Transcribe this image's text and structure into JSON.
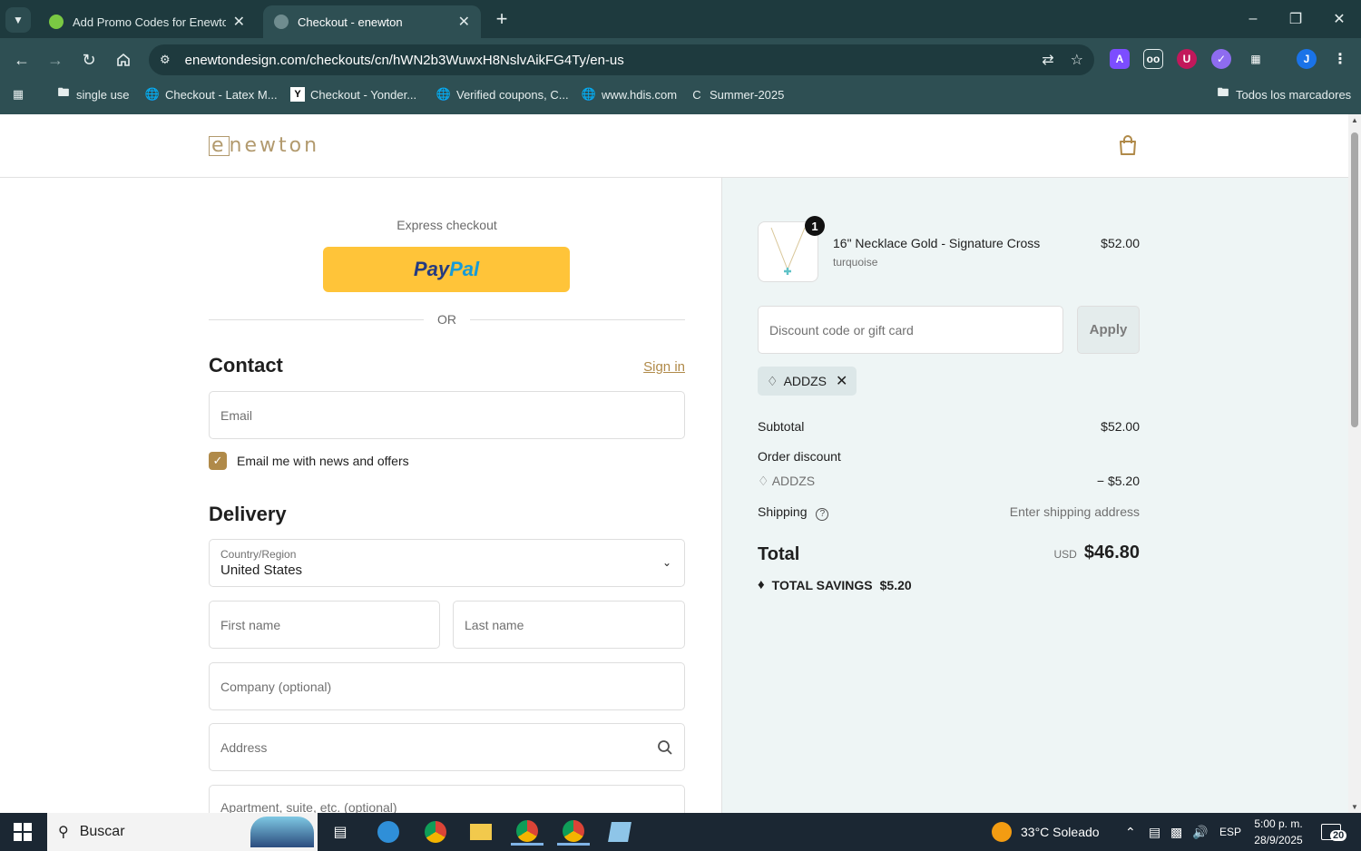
{
  "browser": {
    "tabs": [
      {
        "title": "Add Promo Codes for Enewton",
        "active": false
      },
      {
        "title": "Checkout - enewton",
        "active": true
      }
    ],
    "url": "enewtondesign.com/checkouts/cn/hWN2b3WuwxH8NslvAikFG4Ty/en-us",
    "bookmarks": [
      {
        "label": "single use",
        "icon": "folder-icon"
      },
      {
        "label": "Checkout - Latex M...",
        "icon": "globe-icon"
      },
      {
        "label": "Checkout - Yonder...",
        "icon": "yonder-icon"
      },
      {
        "label": "Verified coupons, C...",
        "icon": "globe-icon"
      },
      {
        "label": "www.hdis.com",
        "icon": "globe-icon"
      },
      {
        "label": "Summer-2025",
        "icon": "c-icon"
      },
      {
        "label": "Todos los marcadores",
        "icon": "folder-icon"
      }
    ],
    "profile_initial": "J"
  },
  "header": {
    "logo_letter": "e",
    "logo_rest": "newton"
  },
  "checkout": {
    "express_label": "Express checkout",
    "paypal_pay": "Pay",
    "paypal_pal": "Pal",
    "or_label": "OR",
    "contact_title": "Contact",
    "sign_in": "Sign in",
    "email_placeholder": "Email",
    "newsletter_label": "Email me with news and offers",
    "newsletter_checked": true,
    "delivery_title": "Delivery",
    "country_label": "Country/Region",
    "country_value": "United States",
    "first_name_placeholder": "First name",
    "last_name_placeholder": "Last name",
    "company_placeholder": "Company (optional)",
    "address_placeholder": "Address",
    "apartment_placeholder": "Apartment, suite, etc. (optional)"
  },
  "summary": {
    "item": {
      "quantity": "1",
      "name": "16\" Necklace Gold - Signature Cross",
      "variant": "turquoise",
      "price": "$52.00"
    },
    "discount_placeholder": "Discount code or gift card",
    "apply_label": "Apply",
    "applied_code": "ADDZS",
    "subtotal_label": "Subtotal",
    "subtotal_value": "$52.00",
    "order_discount_label": "Order discount",
    "discount_code": "ADDZS",
    "discount_value": "− $5.20",
    "shipping_label": "Shipping",
    "shipping_value": "Enter shipping address",
    "total_label": "Total",
    "total_currency": "USD",
    "total_value": "$46.80",
    "savings_label": "TOTAL SAVINGS",
    "savings_value": "$5.20"
  },
  "taskbar": {
    "search_label": "Buscar",
    "weather": "33°C  Soleado",
    "language": "ESP",
    "time": "5:00 p. m.",
    "date": "28/9/2025",
    "notifications": "20"
  },
  "colors": {
    "accent": "#b08a49",
    "chrome": "#2e4f53",
    "summary_bg": "#eef5f5",
    "paypal": "#ffc439"
  }
}
